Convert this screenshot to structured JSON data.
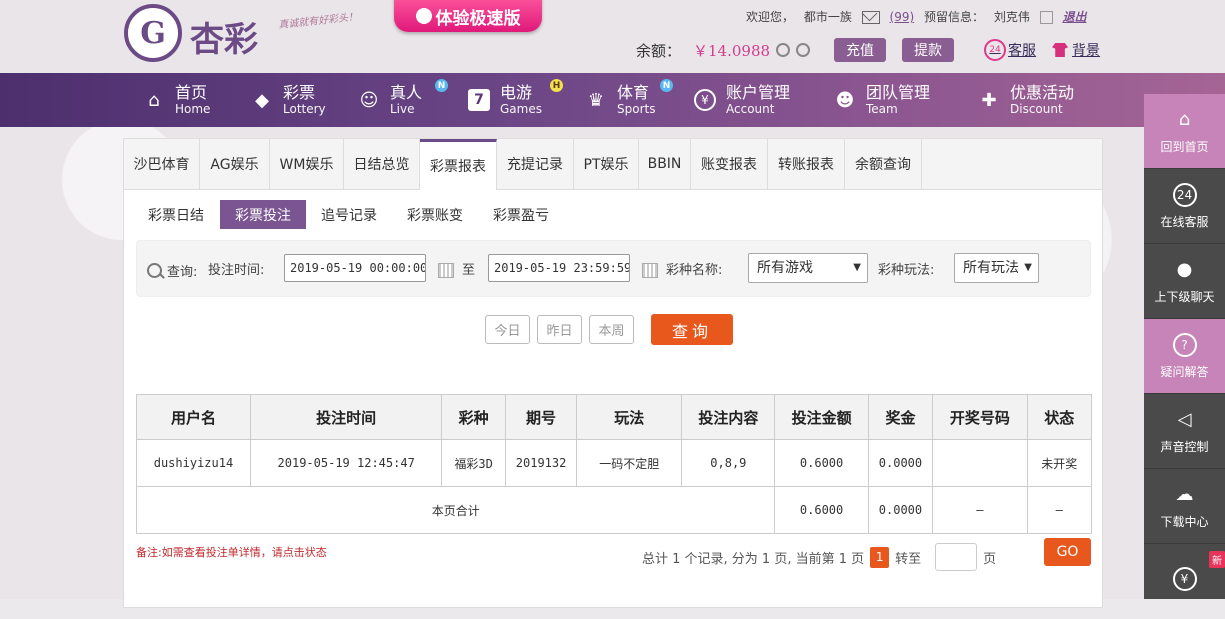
{
  "brand": {
    "name": "杏彩",
    "slogan": "真诚就有好彩头！",
    "speed_label": "体验极速版"
  },
  "topbar": {
    "welcome": "欢迎您，",
    "username": "都市一族",
    "messages": "(99)",
    "reserved_label": "预留信息：",
    "reserved_value": "刘克伟",
    "logout": "退出",
    "balance_label": "余额：",
    "balance_value": "￥14.0988",
    "deposit": "充值",
    "withdraw": "提款",
    "service": "客服",
    "skin": "背景"
  },
  "nav": [
    {
      "cn": "首页",
      "en": "Home",
      "icon": "home-icon"
    },
    {
      "cn": "彩票",
      "en": "Lottery",
      "icon": "lottery-icon"
    },
    {
      "cn": "真人",
      "en": "Live",
      "icon": "live-icon",
      "badge": "N"
    },
    {
      "cn": "电游",
      "en": "Games",
      "icon": "games-icon",
      "badge": "H"
    },
    {
      "cn": "体育",
      "en": "Sports",
      "icon": "trophy-icon",
      "badge": "N"
    },
    {
      "cn": "账户管理",
      "en": "Account",
      "icon": "yen-icon"
    },
    {
      "cn": "团队管理",
      "en": "Team",
      "icon": "team-icon"
    },
    {
      "cn": "优惠活动",
      "en": "Discount",
      "icon": "gift-icon"
    }
  ],
  "tabs": [
    "沙巴体育",
    "AG娱乐",
    "WM娱乐",
    "日结总览",
    "彩票报表",
    "充提记录",
    "PT娱乐",
    "BBIN",
    "账变报表",
    "转账报表",
    "余额查询"
  ],
  "subtabs": [
    "彩票日结",
    "彩票投注",
    "追号记录",
    "彩票账变",
    "彩票盈亏"
  ],
  "query": {
    "label": "查询:",
    "time_label": "投注时间:",
    "start": "2019-05-19 00:00:00",
    "to": "至",
    "end": "2019-05-19 23:59:59",
    "game_label": "彩种名称:",
    "game_value": "所有游戏",
    "play_label": "彩种玩法:",
    "play_value": "所有玩法",
    "today": "今日",
    "yesterday": "昨日",
    "week": "本周",
    "submit": "查询"
  },
  "table": {
    "headers": [
      "用户名",
      "投注时间",
      "彩种",
      "期号",
      "玩法",
      "投注内容",
      "投注金额",
      "奖金",
      "开奖号码",
      "状态"
    ],
    "rows": [
      [
        "dushiyizu14",
        "2019-05-19 12:45:47",
        "福彩3D",
        "2019132",
        "一码不定胆",
        "0,8,9",
        "0.6000",
        "0.0000",
        "",
        "未开奖"
      ]
    ],
    "total_label": "本页合计",
    "total_amount": "0.6000",
    "total_bonus": "0.0000",
    "total_dash1": "—",
    "total_dash2": "—"
  },
  "note": "备注:如需查看投注单详情，请点击状态",
  "pager": {
    "text1": "总计 1 个记录, 分为 1 页, 当前第 1 页",
    "current": "1",
    "goto": "转至",
    "unit": "页",
    "go": "GO"
  },
  "sidebar": [
    {
      "label": "回到首页",
      "icon": "home-icon"
    },
    {
      "label": "在线客服",
      "icon": "headset-icon"
    },
    {
      "label": "上下级聊天",
      "icon": "chat-icon"
    },
    {
      "label": "疑问解答",
      "icon": "question-icon"
    },
    {
      "label": "声音控制",
      "icon": "speaker-icon"
    },
    {
      "label": "下载中心",
      "icon": "download-icon"
    },
    {
      "label": "",
      "icon": "money-bag-icon",
      "badge": "新"
    }
  ],
  "colors": {
    "brand": "#6b4a86",
    "accent": "#e8581c",
    "pink": "#d23d8e",
    "status_green": "#2c8a2c"
  }
}
